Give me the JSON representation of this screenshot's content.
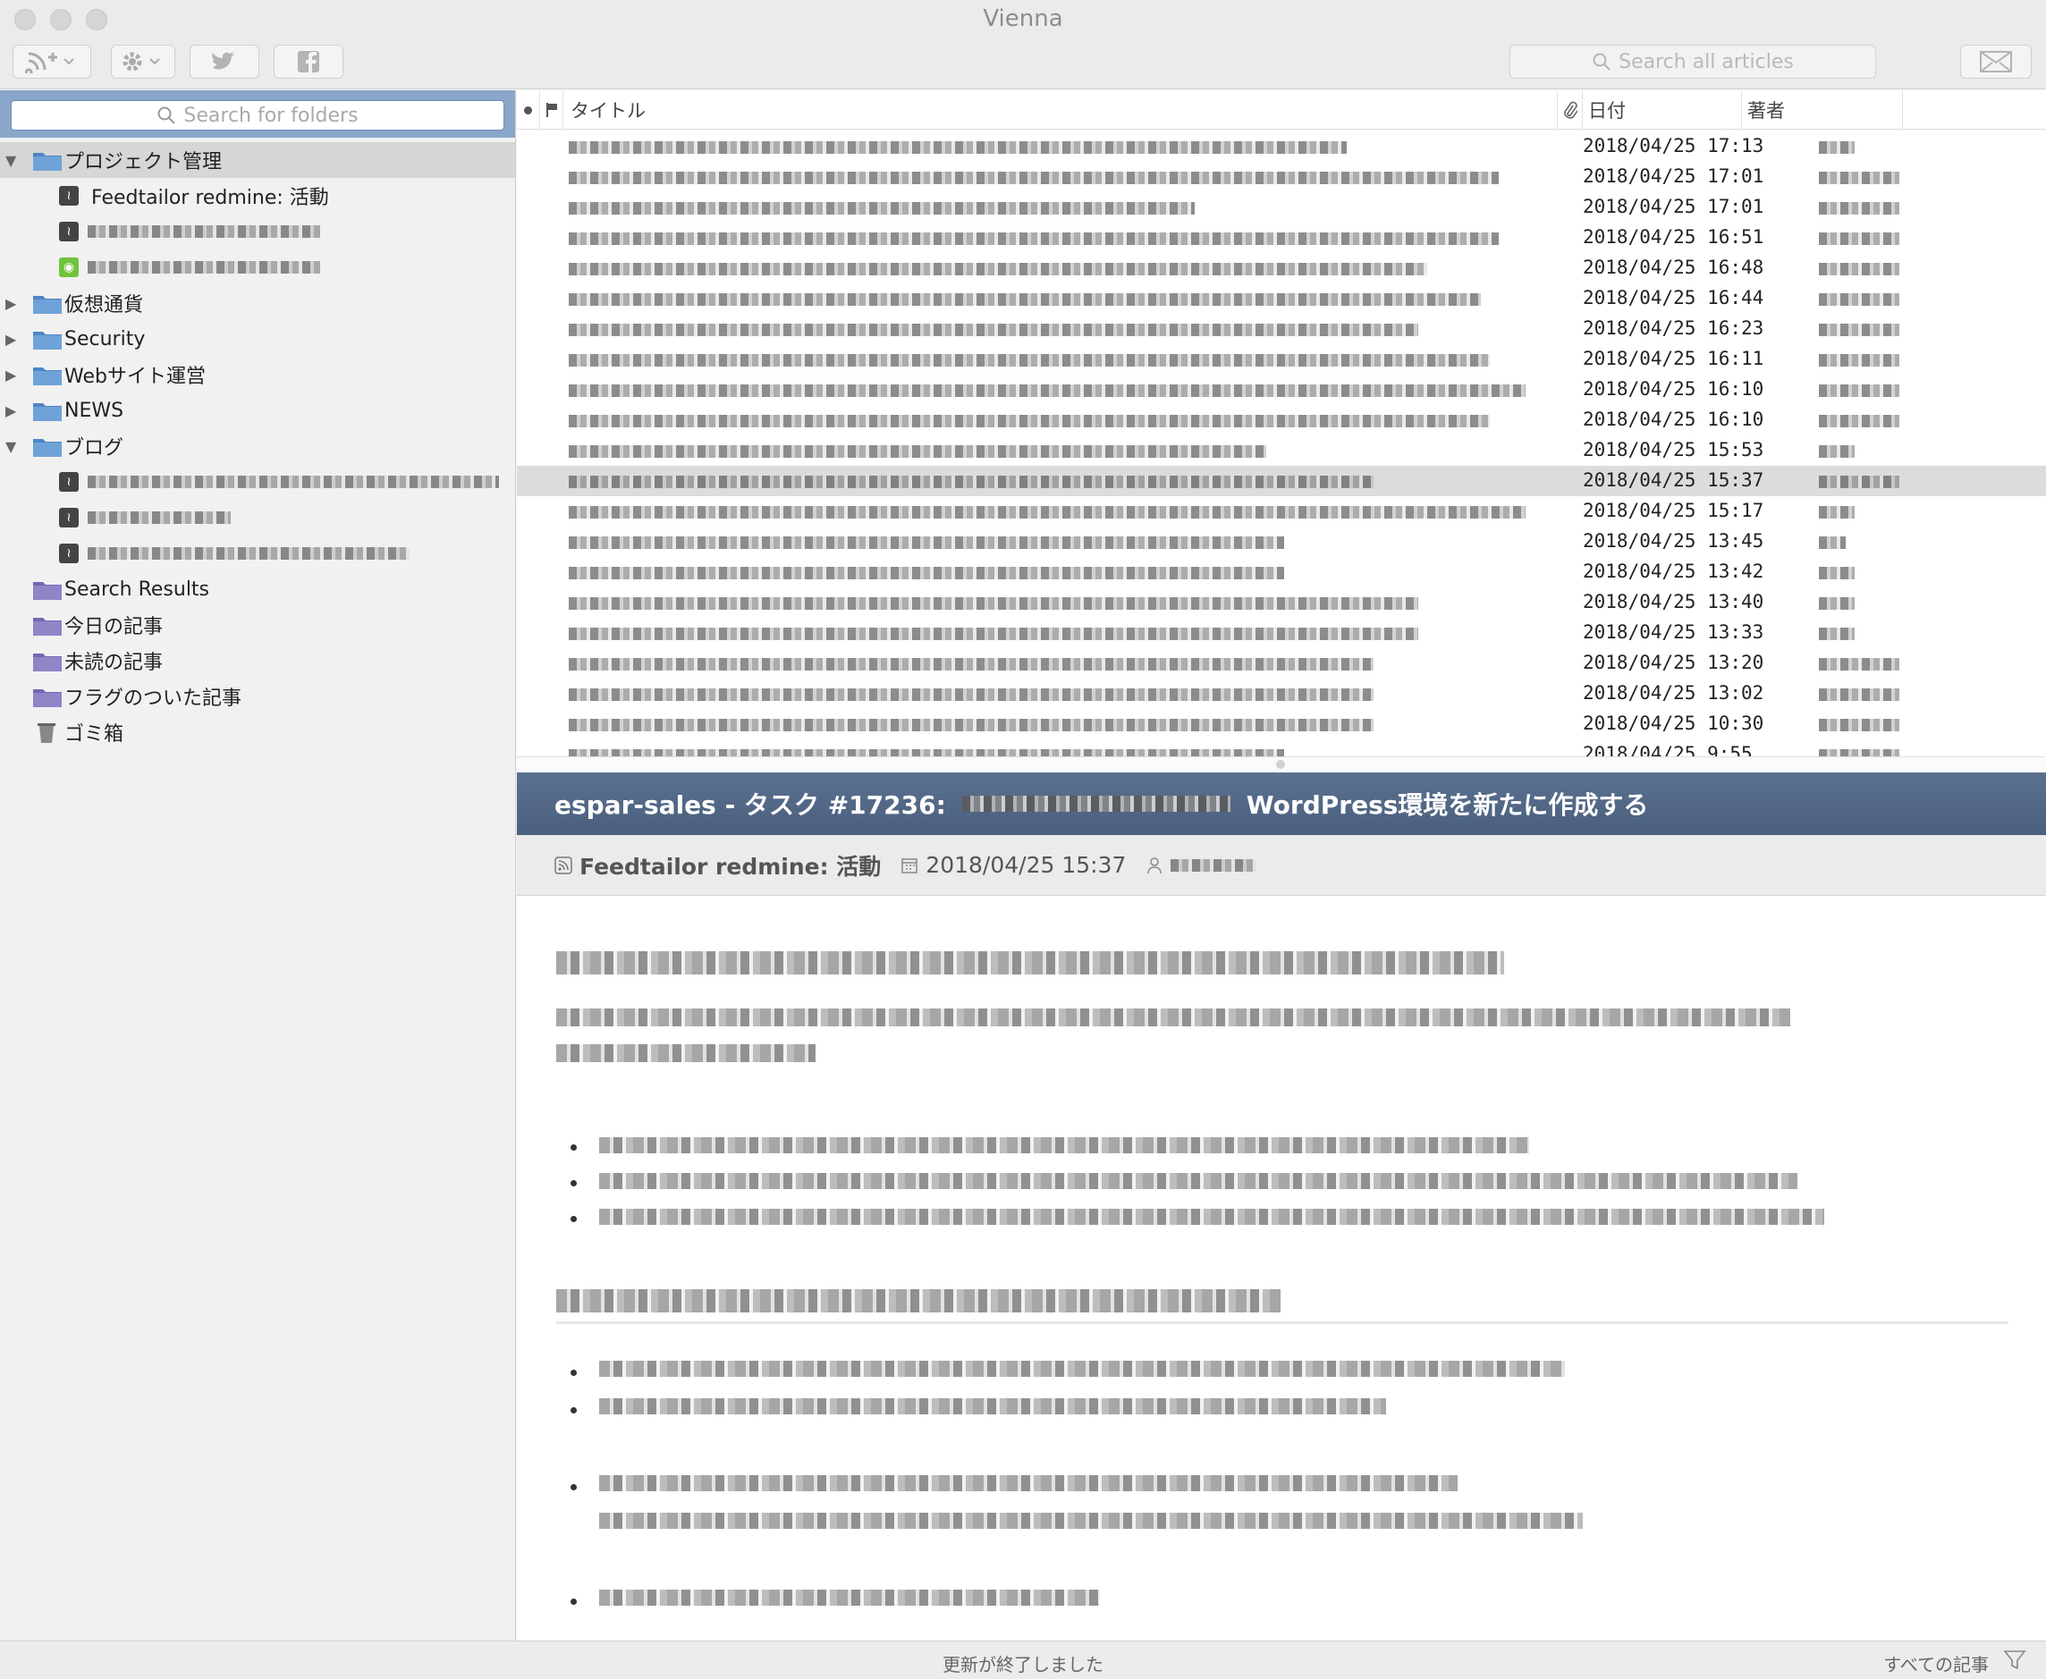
{
  "window": {
    "title": "Vienna"
  },
  "toolbar": {
    "search_placeholder": "Search all articles"
  },
  "sidebar": {
    "search_placeholder": "Search for folders",
    "items": [
      {
        "label": "プロジェクト管理",
        "kind": "folder",
        "expanded": true,
        "selected": true
      },
      {
        "label": "Feedtailor redmine: 活動",
        "kind": "feed"
      },
      {
        "label": "",
        "kind": "feed"
      },
      {
        "label": "",
        "kind": "feed"
      },
      {
        "label": "仮想通貨",
        "kind": "folder",
        "expanded": false
      },
      {
        "label": "Security",
        "kind": "folder",
        "expanded": false
      },
      {
        "label": "Webサイト運営",
        "kind": "folder",
        "expanded": false
      },
      {
        "label": "NEWS",
        "kind": "folder",
        "expanded": false
      },
      {
        "label": "ブログ",
        "kind": "folder",
        "expanded": true
      },
      {
        "label": "",
        "kind": "feed"
      },
      {
        "label": "",
        "kind": "feed"
      },
      {
        "label": "",
        "kind": "feed"
      },
      {
        "label": "Search Results",
        "kind": "smart"
      },
      {
        "label": "今日の記事",
        "kind": "smart"
      },
      {
        "label": "未読の記事",
        "kind": "smart"
      },
      {
        "label": "フラグのついた記事",
        "kind": "smart"
      },
      {
        "label": "ゴミ箱",
        "kind": "trash"
      }
    ]
  },
  "list": {
    "columns": {
      "title": "タイトル",
      "date": "日付",
      "author": "著者"
    },
    "rows": [
      {
        "date": "2018/04/25 17:13"
      },
      {
        "date": "2018/04/25 17:01"
      },
      {
        "date": "2018/04/25 17:01"
      },
      {
        "date": "2018/04/25 16:51"
      },
      {
        "date": "2018/04/25 16:48"
      },
      {
        "date": "2018/04/25 16:44"
      },
      {
        "date": "2018/04/25 16:23"
      },
      {
        "date": "2018/04/25 16:11"
      },
      {
        "date": "2018/04/25 16:10"
      },
      {
        "date": "2018/04/25 16:10"
      },
      {
        "date": "2018/04/25 15:53"
      },
      {
        "date": "2018/04/25 15:37",
        "selected": true
      },
      {
        "date": "2018/04/25 15:17"
      },
      {
        "date": "2018/04/25 13:45"
      },
      {
        "date": "2018/04/25 13:42"
      },
      {
        "date": "2018/04/25 13:40"
      },
      {
        "date": "2018/04/25 13:33"
      },
      {
        "date": "2018/04/25 13:20"
      },
      {
        "date": "2018/04/25 13:02"
      },
      {
        "date": "2018/04/25 10:30"
      },
      {
        "date": "2018/04/25 9:55"
      }
    ]
  },
  "article": {
    "title_prefix": "espar-sales - タスク #17236:",
    "title_suffix": "WordPress環境を新たに作成する",
    "feed": "Feedtailor redmine: 活動",
    "date": "2018/04/25 15:37"
  },
  "status": {
    "text": "更新が終了しました",
    "filter": "すべての記事"
  }
}
